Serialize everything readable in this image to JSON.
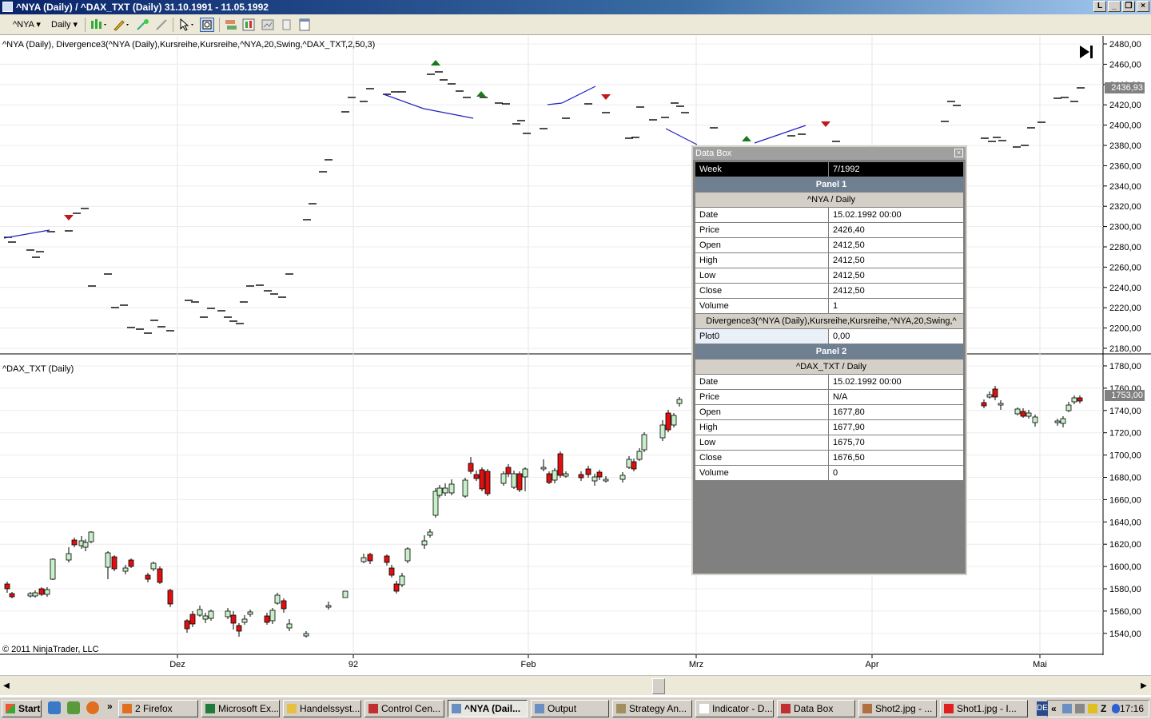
{
  "window": {
    "title": "^NYA (Daily) / ^DAX_TXT (Daily)  31.10.1991 - 11.05.1992"
  },
  "toolbar": {
    "instrument": "^NYA",
    "interval": "Daily"
  },
  "chart": {
    "panel1_label": "^NYA (Daily), Divergence3(^NYA (Daily),Kursreihe,Kursreihe,^NYA,20,Swing,^DAX_TXT,2,50,3)",
    "panel2_label": "^DAX_TXT (Daily)",
    "copyright": "© 2011 NinjaTrader, LLC",
    "panel1_axis": [
      "2480,00",
      "2460,00",
      "2440,00",
      "2420,00",
      "2400,00",
      "2380,00",
      "2360,00",
      "2340,00",
      "2320,00",
      "2300,00",
      "2280,00",
      "2260,00",
      "2240,00",
      "2220,00",
      "2200,00",
      "2180,00"
    ],
    "panel2_axis": [
      "1780,00",
      "1760,00",
      "1740,00",
      "1720,00",
      "1700,00",
      "1680,00",
      "1660,00",
      "1640,00",
      "1620,00",
      "1600,00",
      "1580,00",
      "1560,00",
      "1540,00"
    ],
    "panel1_last_price": "2436,93",
    "panel2_last_price": "1753,00",
    "x_labels": [
      "Dez",
      "92",
      "Feb",
      "Mrz",
      "Apr",
      "Mai"
    ],
    "colors": {
      "up": "#c8f0c8",
      "down": "#e01010",
      "divergence_line": "#2020c0",
      "arrow_up": "#1a7a1a",
      "arrow_down": "#c01818"
    }
  },
  "databox": {
    "title": "Data Box",
    "week_label": "Week",
    "week_value": "7/1992",
    "panel1": {
      "header": "Panel 1",
      "series": "^NYA / Daily",
      "rows": [
        {
          "k": "Date",
          "v": "15.02.1992 00:00"
        },
        {
          "k": "Price",
          "v": "2426,40"
        },
        {
          "k": "Open",
          "v": "2412,50"
        },
        {
          "k": "High",
          "v": "2412,50"
        },
        {
          "k": "Low",
          "v": "2412,50"
        },
        {
          "k": "Close",
          "v": "2412,50"
        },
        {
          "k": "Volume",
          "v": "1"
        }
      ],
      "indicator": "Divergence3(^NYA (Daily),Kursreihe,Kursreihe,^NYA,20,Swing,^",
      "plot_label": "Plot0",
      "plot_value": "0,00"
    },
    "panel2": {
      "header": "Panel 2",
      "series": "^DAX_TXT / Daily",
      "rows": [
        {
          "k": "Date",
          "v": "15.02.1992 00:00"
        },
        {
          "k": "Price",
          "v": "N/A"
        },
        {
          "k": "Open",
          "v": "1677,80"
        },
        {
          "k": "High",
          "v": "1677,90"
        },
        {
          "k": "Low",
          "v": "1675,70"
        },
        {
          "k": "Close",
          "v": "1676,50"
        },
        {
          "k": "Volume",
          "v": "0"
        }
      ]
    }
  },
  "taskbar": {
    "start": "Start",
    "tasks": [
      {
        "label": "2 Firefox",
        "active": false
      },
      {
        "label": "Microsoft Ex...",
        "active": false
      },
      {
        "label": "Handelssyst...",
        "active": false
      },
      {
        "label": "Control Cen...",
        "active": false
      },
      {
        "label": "^NYA (Dail...",
        "active": true
      },
      {
        "label": "Output",
        "active": false
      },
      {
        "label": "Strategy An...",
        "active": false
      },
      {
        "label": "Indicator - D...",
        "active": false
      },
      {
        "label": "Data Box",
        "active": false
      },
      {
        "label": "Shot2.jpg - ...",
        "active": false
      },
      {
        "label": "Shot1.jpg - I...",
        "active": false
      }
    ],
    "lang": "DE",
    "clock": "17:16"
  }
}
